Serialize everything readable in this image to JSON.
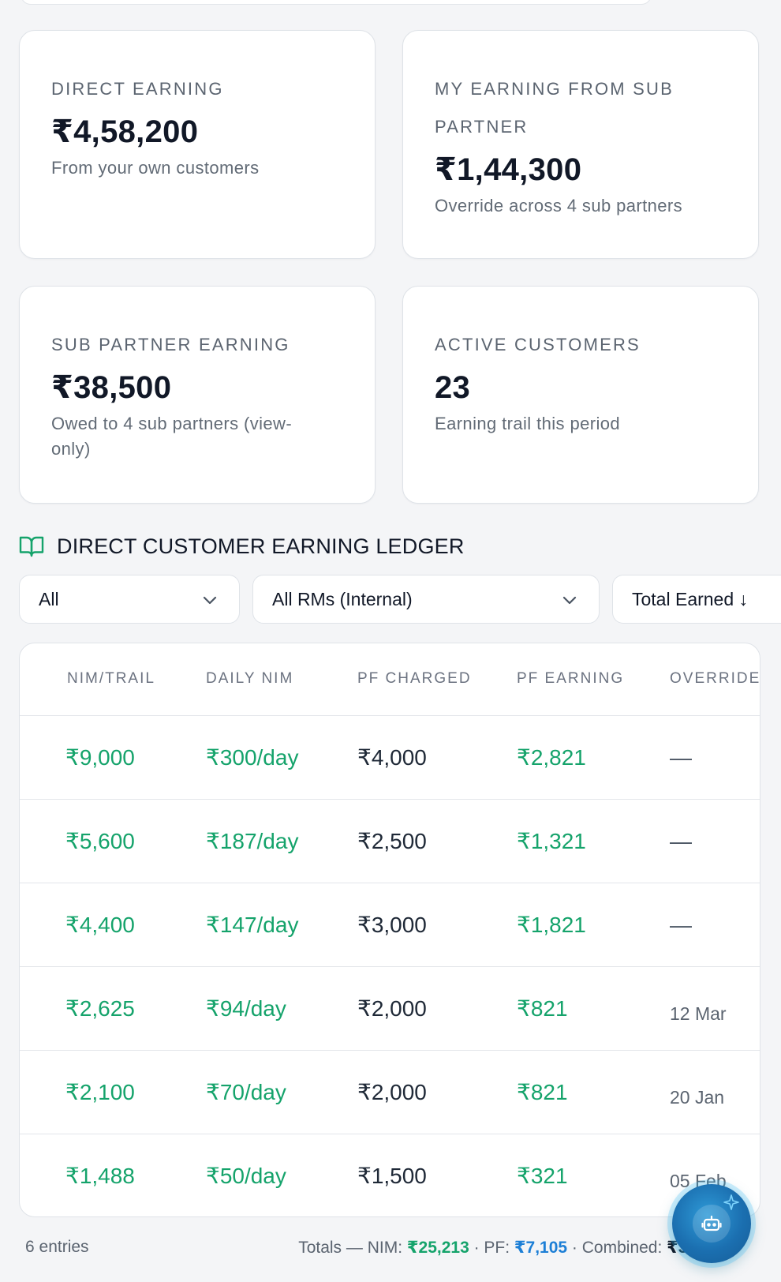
{
  "cards": [
    {
      "label": "DIRECT EARNING",
      "value": "₹4,58,200",
      "sub": "From your own customers"
    },
    {
      "label_line1": "MY EARNING FROM SUB",
      "label_line2": "PARTNER",
      "value": "₹1,44,300",
      "sub": "Override across 4 sub partners"
    },
    {
      "label": "SUB PARTNER EARNING",
      "value": "₹38,500",
      "sub_line1": "Owed to 4 sub partners (view-",
      "sub_line2": "only)"
    },
    {
      "label": "ACTIVE CUSTOMERS",
      "value": "23",
      "sub": "Earning trail this period"
    }
  ],
  "ledger": {
    "title": "DIRECT CUSTOMER EARNING LEDGER",
    "filters": {
      "status": "All",
      "rm": "All RMs (Internal)",
      "sort": "Total Earned ↓"
    },
    "columns": [
      "NIM/TRAIL",
      "DAILY NIM",
      "PF CHARGED",
      "PF EARNING",
      "OVERRIDE"
    ],
    "rows": [
      [
        "₹9,000",
        "₹300/day",
        "₹4,000",
        "₹2,821",
        "—"
      ],
      [
        "₹5,600",
        "₹187/day",
        "₹2,500",
        "₹1,321",
        "—"
      ],
      [
        "₹4,400",
        "₹147/day",
        "₹3,000",
        "₹1,821",
        "—"
      ],
      [
        "₹2,625",
        "₹94/day",
        "₹2,000",
        "₹821",
        "12 Mar"
      ],
      [
        "₹2,100",
        "₹70/day",
        "₹2,000",
        "₹821",
        "20 Jan"
      ],
      [
        "₹1,488",
        "₹50/day",
        "₹1,500",
        "₹321",
        "05 Feb"
      ]
    ]
  },
  "footer": {
    "entries": "6 entries",
    "totals_prefix": "Totals — NIM: ",
    "nim_total": "₹25,213",
    "sep1": " · PF: ",
    "pf_total": "₹7,105",
    "sep2": " · Combined: ",
    "combined_total": "₹32,318"
  },
  "icons": {
    "ledger": "book-open-icon",
    "fab": "bot-icon"
  },
  "colors": {
    "positive": "#15a36b",
    "pf_total": "#1d7fd6"
  }
}
